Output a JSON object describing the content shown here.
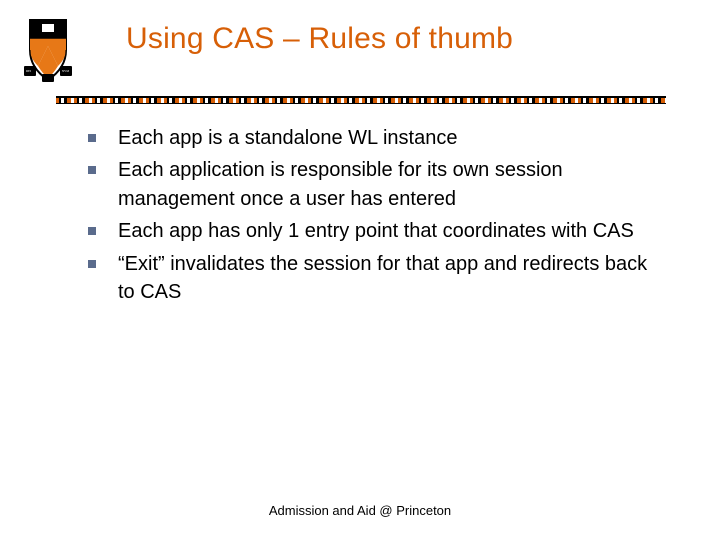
{
  "title": "Using CAS – Rules of thumb",
  "bullets": [
    "Each app is a standalone WL instance",
    "Each application is responsible for its own session management once a user has entered",
    "Each app has only 1 entry point that coordinates with CAS",
    "“Exit” invalidates the session for that app and redirects back to CAS"
  ],
  "footer": "Admission and Aid @ Princeton"
}
